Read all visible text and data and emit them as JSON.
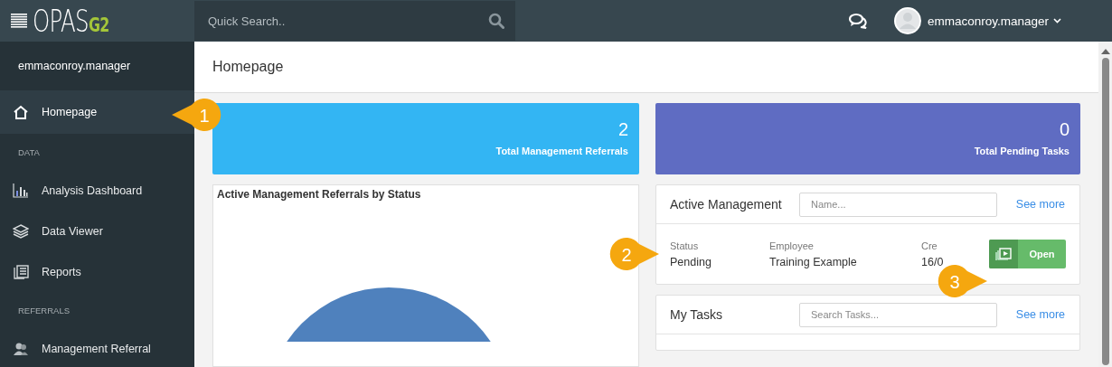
{
  "topbar": {
    "logo_text": "OPAS",
    "logo_suffix": "G2",
    "search": {
      "placeholder": "Quick Search.."
    },
    "user": "emmaconroy.manager"
  },
  "sidebar": {
    "user": "emmaconroy.manager",
    "items": [
      {
        "kind": "link",
        "label": "Homepage",
        "selected": true
      },
      {
        "kind": "header",
        "label": "DATA"
      },
      {
        "kind": "link",
        "label": "Analysis Dashboard",
        "selected": false
      },
      {
        "kind": "link",
        "label": "Data Viewer",
        "selected": false
      },
      {
        "kind": "link",
        "label": "Reports",
        "selected": false
      },
      {
        "kind": "header",
        "label": "REFERRALS"
      },
      {
        "kind": "link",
        "label": "Management Referral",
        "selected": false
      }
    ]
  },
  "page": {
    "title": "Homepage"
  },
  "stats": [
    {
      "value": "2",
      "label": "Total Management Referrals",
      "color": "#33b5f3"
    },
    {
      "value": "0",
      "label": "Total Pending Tasks",
      "color": "#5f6cc2"
    }
  ],
  "chart_panel": {
    "title": "Active Management Referrals by Status"
  },
  "active_management": {
    "title": "Active Management",
    "search": {
      "placeholder": "Name..."
    },
    "link": "See more",
    "columns": [
      "Status",
      "Employee",
      "Cre"
    ],
    "row": [
      "Pending",
      "Training Example",
      "16/0"
    ],
    "button": "Open"
  },
  "my_tasks": {
    "title": "My Tasks",
    "search": {
      "placeholder": "Search Tasks..."
    },
    "link": "See more"
  },
  "callouts": [
    "1",
    "2",
    "3"
  ]
}
